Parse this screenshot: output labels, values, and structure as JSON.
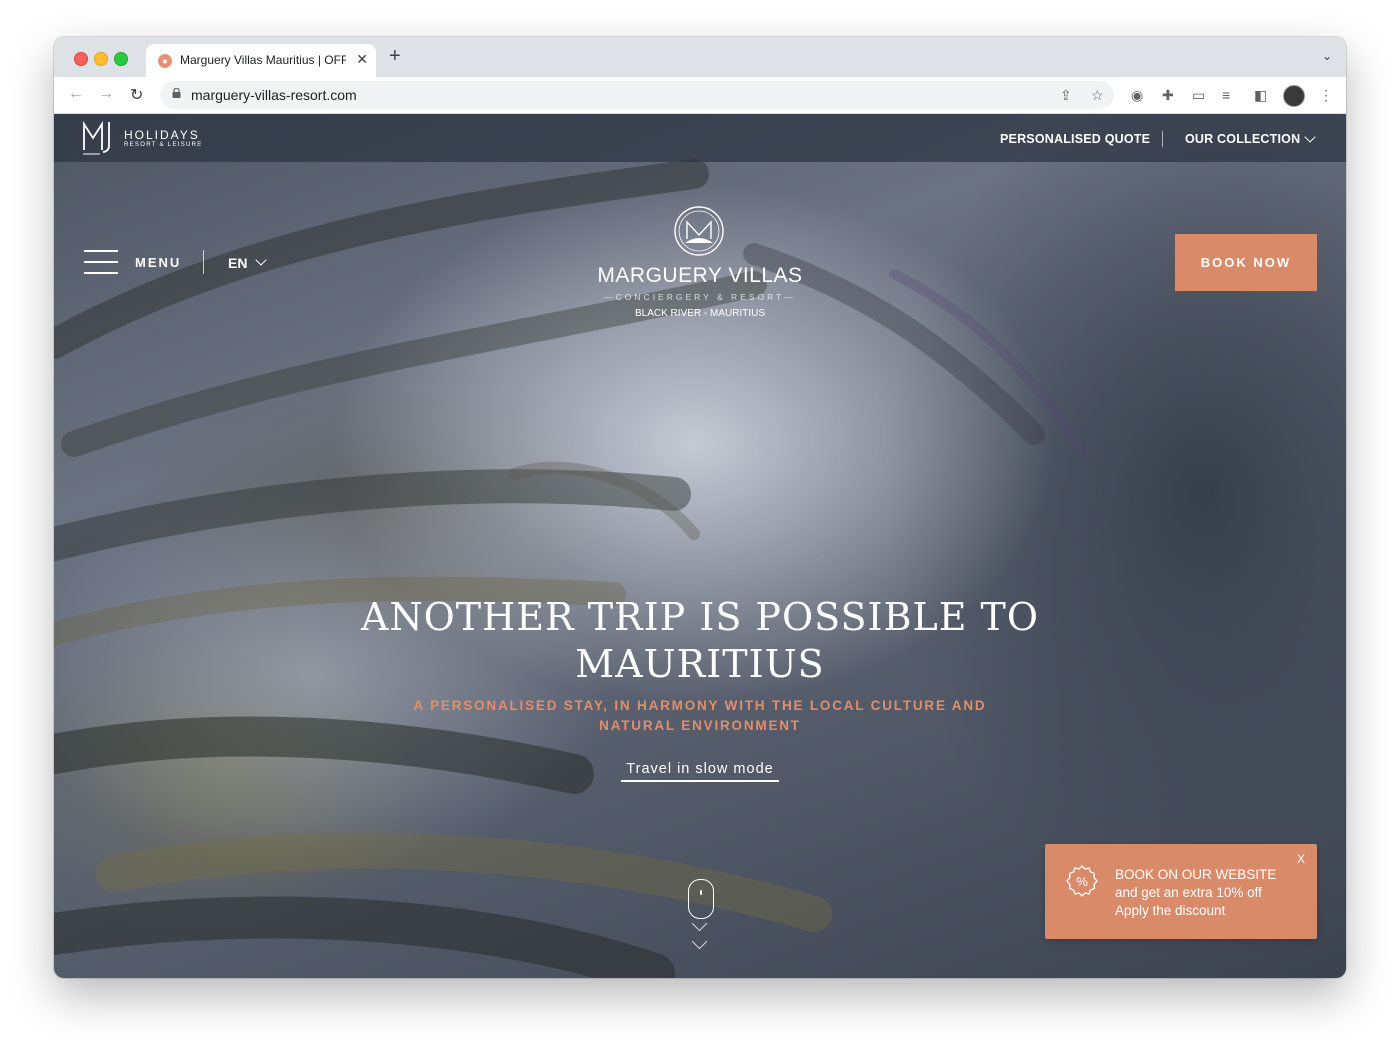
{
  "browser": {
    "tab_title": "Marguery Villas Mauritius | OFF",
    "new_tab_symbol": "+",
    "tab_close_symbol": "✕",
    "url": "marguery-villas-resort.com"
  },
  "site": {
    "logo_holidays": "HOLIDAYS",
    "logo_sub": "RESORT & LEISURE",
    "nav": {
      "personalised_quote": "PERSONALISED QUOTE",
      "our_collection": "OUR COLLECTION"
    },
    "menu_label": "MENU",
    "language": "EN",
    "brand": {
      "name": "MARGUERY VILLAS",
      "tagline": "—CONCIERGERY & RESORT—",
      "location": "BLACK RIVER - MAURITIUS"
    },
    "book_now": "BOOK NOW",
    "hero": {
      "title": "ANOTHER TRIP IS POSSIBLE TO MAURITIUS",
      "subtitle": "A PERSONALISED STAY, IN HARMONY WITH THE LOCAL CULTURE AND NATURAL ENVIRONMENT",
      "link": "Travel in slow mode"
    },
    "promo": {
      "title": "BOOK ON OUR WEBSITE",
      "line2": "and get an extra 10% off",
      "line3": "Apply the discount",
      "close": "X"
    }
  },
  "colors": {
    "accent": "#d98a69",
    "subtitle": "#e08f6c",
    "topbar": "#2d3442"
  }
}
